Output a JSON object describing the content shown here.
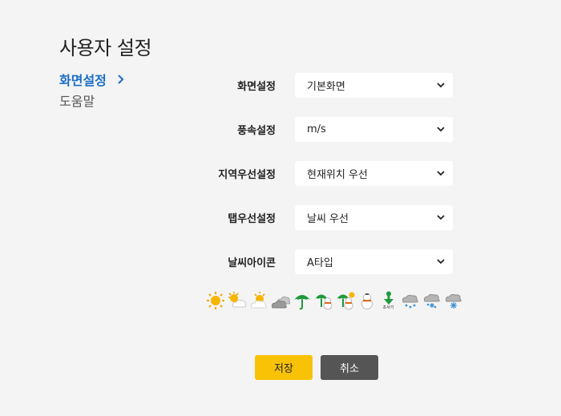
{
  "page": {
    "title": "사용자 설정"
  },
  "sidebar": {
    "items": [
      {
        "label": "화면설정",
        "active": true
      },
      {
        "label": "도움말",
        "active": false
      }
    ]
  },
  "settings": [
    {
      "label": "화면설정",
      "value": "기본화면"
    },
    {
      "label": "풍속설정",
      "value": "m/s"
    },
    {
      "label": "지역우선설정",
      "value": "현재위치 우선"
    },
    {
      "label": "탭우선설정",
      "value": "날씨 우선"
    },
    {
      "label": "날씨아이콘",
      "value": "A타입"
    }
  ],
  "weather_icons": {
    "items": [
      "sun-icon",
      "sun-cloud-icon",
      "sun-cloud-light-icon",
      "cloud-icon",
      "umbrella-icon",
      "umbrella-snowman-icon",
      "umbrella-sun-snowman-icon",
      "snowman-icon",
      "yellow-dust-icon",
      "rain-cloud-icon",
      "rain-snow-cloud-icon",
      "snow-cloud-icon"
    ],
    "yellow_dust_label": "초사기"
  },
  "buttons": {
    "save": "저장",
    "cancel": "취소"
  },
  "colors": {
    "accent_blue": "#1a6ec7",
    "save_yellow": "#f9c206",
    "cancel_gray": "#555555",
    "background": "#f4f4f4"
  }
}
